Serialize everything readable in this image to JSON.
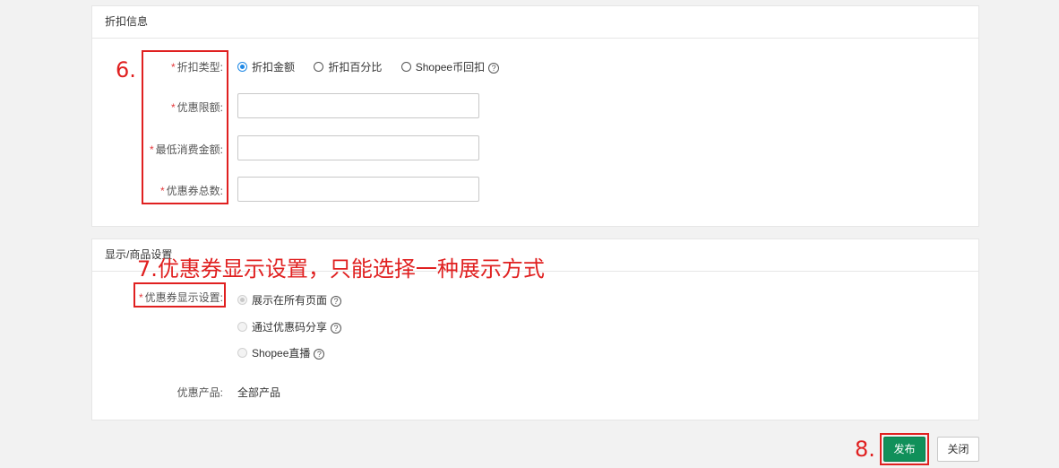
{
  "discount": {
    "title": "折扣信息",
    "type_label": "折扣类型:",
    "type_options": [
      "折扣金额",
      "折扣百分比",
      "Shopee币回扣"
    ],
    "limit_label": "优惠限额:",
    "min_spend_label": "最低消费金额:",
    "total_label": "优惠券总数:",
    "limit_value": "",
    "min_spend_value": "",
    "total_value": ""
  },
  "display": {
    "title": "显示/商品设置",
    "setting_label": "优惠券显示设置:",
    "options": [
      "展示在所有页面",
      "通过优惠码分享",
      "Shopee直播"
    ],
    "product_label": "优惠产品:",
    "product_value": "全部产品"
  },
  "annotations": {
    "step6": "6.",
    "step7": "7.优惠券显示设置，只能选择一种展示方式",
    "step8": "8."
  },
  "footer": {
    "publish_label": "发布",
    "close_label": "关闭"
  },
  "colors": {
    "accent": "#1e88e5",
    "primary_button": "#10905a",
    "annotation": "#e02020",
    "required": "#e4393c"
  },
  "icons": {
    "help": "question-circle-icon",
    "radio": "radio-icon"
  }
}
